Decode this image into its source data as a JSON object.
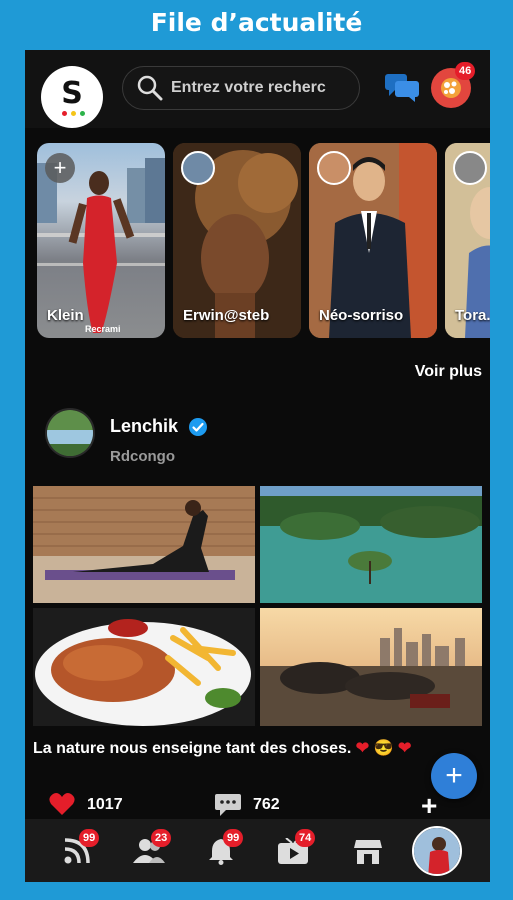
{
  "banner": {
    "title": "File d’actualité"
  },
  "header": {
    "search_placeholder": "Entrez votre recherc",
    "notifications_badge": "46"
  },
  "stories": [
    {
      "label": "Klein",
      "sublabel": "Recrami",
      "add": true
    },
    {
      "label": "Erwin@steb"
    },
    {
      "label": "Néo-sorriso"
    },
    {
      "label": "Tora..."
    }
  ],
  "stories_more_label": "Voir plus",
  "post": {
    "author": "Lenchik",
    "location": "Rdcongo",
    "caption": "La nature nous enseigne tant des choses.",
    "caption_emojis": [
      "❤",
      "😎",
      "❤"
    ],
    "likes": "1017",
    "comments": "762",
    "add_label": "+"
  },
  "fab_label": "+",
  "nav": {
    "items": [
      {
        "name": "feed",
        "badge": "99"
      },
      {
        "name": "friends",
        "badge": "23"
      },
      {
        "name": "notifications",
        "badge": "99"
      },
      {
        "name": "videos",
        "badge": "74"
      },
      {
        "name": "store"
      },
      {
        "name": "profile"
      }
    ]
  },
  "colors": {
    "banner": "#1f9ad6",
    "badge": "#e51e2a",
    "fab": "#2f7fd8",
    "verified": "#1d9bf0"
  }
}
